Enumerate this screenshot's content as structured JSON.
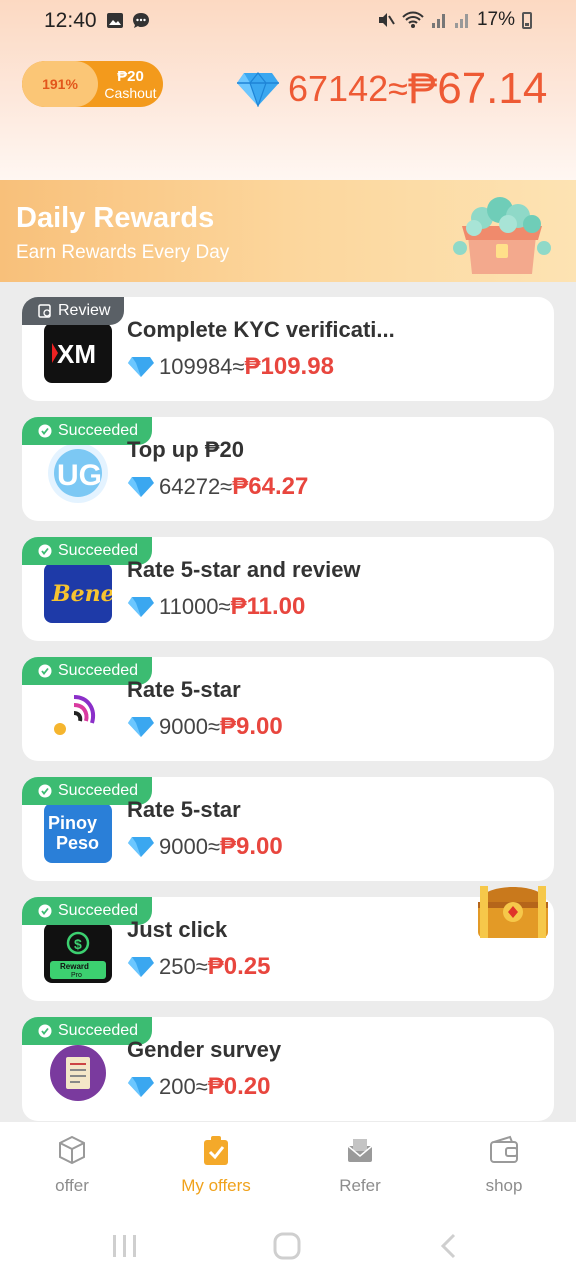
{
  "status": {
    "time": "12:40",
    "battery": "17%"
  },
  "header": {
    "cashout_percent": "191%",
    "cashout_amount": "₱20",
    "cashout_label": "Cashout",
    "balance_gems": "67142≈",
    "balance_php": "₱67.14"
  },
  "banner": {
    "title": "Daily Rewards",
    "subtitle": "Earn Rewards Every Day"
  },
  "offers": [
    {
      "badge": "Review",
      "status": "review",
      "title": "Complete KYC verificati...",
      "gems": "109984≈",
      "php": "₱109.98",
      "app": "xm-app-icon"
    },
    {
      "badge": "Succeeded",
      "status": "succeeded",
      "title": "Top up ₱20",
      "gems": "64272≈",
      "php": "₱64.27",
      "app": "ug-app-icon"
    },
    {
      "badge": "Succeeded",
      "status": "succeeded",
      "title": "Rate 5-star and review",
      "gems": "11000≈",
      "php": "₱11.00",
      "app": "bene-app-icon"
    },
    {
      "badge": "Succeeded",
      "status": "succeeded",
      "title": "Rate 5-star",
      "gems": "9000≈",
      "php": "₱9.00",
      "app": "signal-app-icon"
    },
    {
      "badge": "Succeeded",
      "status": "succeeded",
      "title": "Rate 5-star",
      "gems": "9000≈",
      "php": "₱9.00",
      "app": "pinoy-peso-app-icon"
    },
    {
      "badge": "Succeeded",
      "status": "succeeded",
      "title": "Just click",
      "gems": "250≈",
      "php": "₱0.25",
      "app": "reward-pro-app-icon"
    },
    {
      "badge": "Succeeded",
      "status": "succeeded",
      "title": "Gender survey",
      "gems": "200≈",
      "php": "₱0.20",
      "app": "survey-app-icon"
    }
  ],
  "app_icon_text": {
    "bene": "Bene",
    "pinoy1": "Pinoy",
    "pinoy2": "Peso",
    "reward1": "Reward",
    "reward2": "Pro"
  },
  "nav": [
    {
      "label": "offer",
      "active": false
    },
    {
      "label": "My offers",
      "active": true
    },
    {
      "label": "Refer",
      "active": false
    },
    {
      "label": "shop",
      "active": false
    }
  ],
  "colors": {
    "accent": "#f0a21c",
    "price": "#e8463e",
    "success": "#3cbc72",
    "review": "#5a6066"
  }
}
